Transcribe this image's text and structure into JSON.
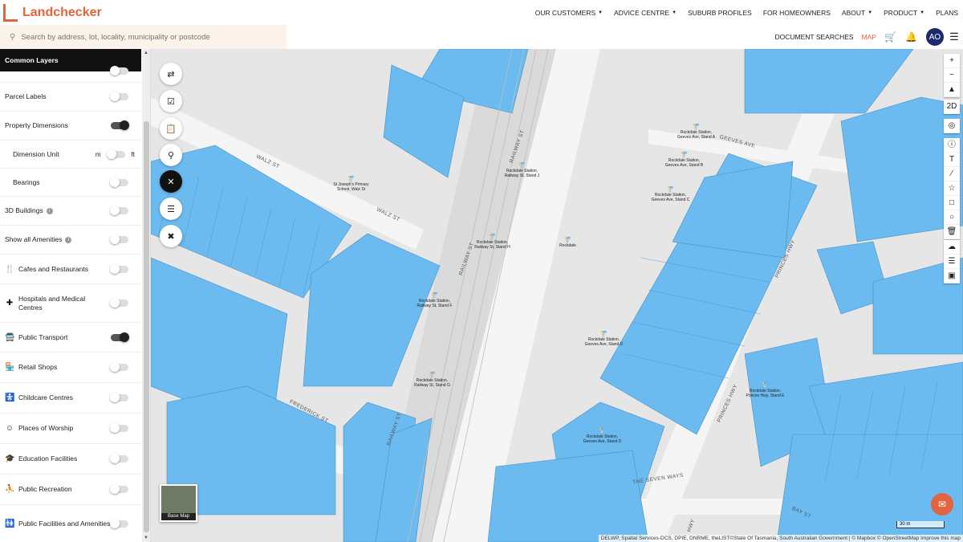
{
  "brand": {
    "name": "Landchecker"
  },
  "nav": {
    "items": [
      {
        "label": "OUR CUSTOMERS",
        "dropdown": true
      },
      {
        "label": "ADVICE CENTRE",
        "dropdown": true
      },
      {
        "label": "SUBURB PROFILES",
        "dropdown": false
      },
      {
        "label": "FOR HOMEOWNERS",
        "dropdown": false
      },
      {
        "label": "ABOUT",
        "dropdown": true
      },
      {
        "label": "PRODUCT",
        "dropdown": true
      },
      {
        "label": "PLANS",
        "dropdown": false
      }
    ]
  },
  "search": {
    "placeholder": "Search by address, lot, locality, municipality or postcode"
  },
  "toolbar": {
    "document_searches": "DOCUMENT SEARCHES",
    "map": "MAP",
    "avatar_initials": "AO"
  },
  "sidebar": {
    "heading": "Common Layers",
    "rows": [
      {
        "label": "Parcel Labels",
        "on": false,
        "icon": ""
      },
      {
        "label": "Property Dimensions",
        "on": true,
        "icon": ""
      },
      {
        "label": "Dimension Unit",
        "unit_left": "m",
        "unit_right": "ft",
        "on": false,
        "indent": true
      },
      {
        "label": "Bearings",
        "on": false,
        "indent": true
      },
      {
        "label": "3D Buildings",
        "on": false,
        "info": true
      },
      {
        "label": "Show all Amenities",
        "on": false,
        "info": true
      },
      {
        "label": "Cafes and Restaurants",
        "on": false,
        "icon": "cutlery-icon"
      },
      {
        "label": "Hospitals and Medical Centres",
        "on": false,
        "icon": "medical-cross-icon"
      },
      {
        "label": "Public Transport",
        "on": true,
        "icon": "bus-icon"
      },
      {
        "label": "Retail Shops",
        "on": false,
        "icon": "shop-icon"
      },
      {
        "label": "Childcare Centres",
        "on": false,
        "icon": "stroller-icon"
      },
      {
        "label": "Places of Worship",
        "on": false,
        "icon": "worship-icon"
      },
      {
        "label": "Education Facilities",
        "on": false,
        "icon": "graduation-cap-icon"
      },
      {
        "label": "Public Recreation",
        "on": false,
        "icon": "recreation-icon"
      },
      {
        "label": "Public Facilities and Amenities",
        "on": false,
        "icon": "facilities-icon"
      }
    ]
  },
  "map": {
    "streets": [
      "WALZ ST",
      "WALZ ST",
      "FREDERICK ST",
      "RAILWAY ST",
      "RAILWAY ST",
      "RAILWAY ST",
      "GEEVES AVE",
      "PRINCES HWY",
      "PRINCES HWY",
      "THE SEVEN WAYS",
      "BAY ST",
      "HWY"
    ],
    "stops": [
      {
        "label": "Rockdale Station, Geeves Ave, Stand A"
      },
      {
        "label": "Rockdale Station, Geeves Ave, Stand B"
      },
      {
        "label": "Rockdale Station, Geeves Ave, Stand C"
      },
      {
        "label": "Rockdale Station, Railway St, Stand J"
      },
      {
        "label": "St Joseph's Primary School, Walz St"
      },
      {
        "label": "Rockdale Station, Railway St, Stand H"
      },
      {
        "label": "Rockdale"
      },
      {
        "label": "Rockdale Station, Railway St, Stand F"
      },
      {
        "label": "Rockdale Station, Railway St, Stand G"
      },
      {
        "label": "Rockdale Station, Geeves Ave, Stand D"
      },
      {
        "label": "Rockdale Station, Princes Hwy, Stand E"
      },
      {
        "label": "Rockdale Station, Geeves Ave, Stand D"
      }
    ],
    "basemap_label": "Base Map",
    "scale_label": "30 m",
    "attribution": "DELWP, Spatial Services-DCS, DPIE, DNRME, theLIST©State Of Tasmania, South Australian Government | © Mapbox © OpenStreetMap  Improve this map",
    "colors": {
      "parcel": "#6bbbf0",
      "road": "#f4f4f4",
      "background": "#e8e8e8",
      "accent": "#e0643d"
    }
  }
}
